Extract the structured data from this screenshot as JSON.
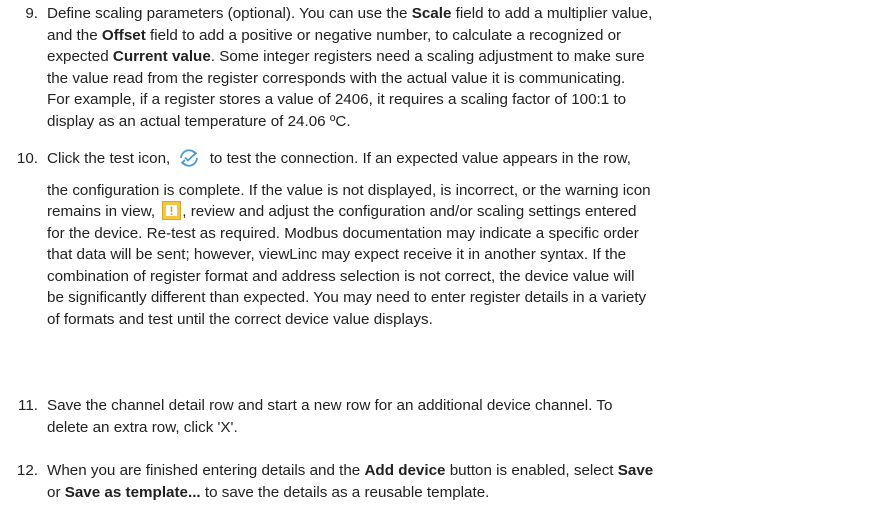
{
  "steps": [
    {
      "number": "9.",
      "lines": [
        {
          "parts": [
            {
              "t": "Define scaling parameters (optional). You can use the "
            },
            {
              "t": "Scale",
              "b": true
            },
            {
              "t": " field to add a multiplier value,"
            }
          ]
        },
        {
          "parts": [
            {
              "t": "and the "
            },
            {
              "t": "Offset",
              "b": true
            },
            {
              "t": " field to add a positive or negative number, to calculate a recognized or"
            }
          ]
        },
        {
          "parts": [
            {
              "t": "expected "
            },
            {
              "t": "Current value",
              "b": true
            },
            {
              "t": ". Some integer registers need a scaling adjustment to make sure"
            }
          ]
        },
        {
          "parts": [
            {
              "t": "the value read from the register corresponds with the actual value it is communicating."
            }
          ]
        },
        {
          "parts": [
            {
              "t": "For example, if a register stores a value of 2406, it requires a scaling factor of 100:1 to"
            }
          ]
        },
        {
          "parts": [
            {
              "t": "display as an actual temperature of 24.06 ºC."
            }
          ]
        }
      ]
    },
    {
      "number": "10.",
      "lines": [
        {
          "parts": [
            {
              "t": "Click the test icon, "
            },
            {
              "icon": "test-icon"
            },
            {
              "t": " to test the connection. If an expected value appears in the row,"
            }
          ]
        },
        {
          "gap": true
        },
        {
          "parts": [
            {
              "t": "the configuration is complete. If the value is not displayed, is incorrect, or the warning icon"
            }
          ]
        },
        {
          "parts": [
            {
              "t": "remains in view, "
            },
            {
              "icon": "warning-icon"
            },
            {
              "t": ", review and adjust the configuration and/or scaling settings entered"
            }
          ]
        },
        {
          "parts": [
            {
              "t": "for the device. Re-test as required. Modbus documentation may indicate a specific order"
            }
          ]
        },
        {
          "parts": [
            {
              "t": "that data will be sent; however, viewLinc may expect receive it in another syntax. If the"
            }
          ]
        },
        {
          "parts": [
            {
              "t": "combination of register format and address selection is not correct, the device value will"
            }
          ]
        },
        {
          "parts": [
            {
              "t": "be significantly different than expected. You may need to enter register details in a variety"
            }
          ]
        },
        {
          "parts": [
            {
              "t": "of formats and test until the correct device value displays."
            }
          ]
        }
      ]
    },
    {
      "number": "11.",
      "lines": [
        {
          "parts": [
            {
              "t": "Save the channel detail row and start a new row for an additional device channel. To"
            }
          ]
        },
        {
          "parts": [
            {
              "t": "delete an extra row, click 'X'."
            }
          ]
        }
      ]
    },
    {
      "number": "12.",
      "lines": [
        {
          "parts": [
            {
              "t": "When you are finished entering details and the "
            },
            {
              "t": "Add device",
              "b": true
            },
            {
              "t": " button is enabled, select "
            },
            {
              "t": "Save",
              "b": true
            }
          ]
        },
        {
          "parts": [
            {
              "t": "or "
            },
            {
              "t": "Save as template...",
              "b": true
            },
            {
              "t": " to save the details as a reusable template."
            }
          ]
        }
      ]
    }
  ],
  "icons": {
    "test-icon": {
      "name": "test-icon",
      "color": "#4a9bd1"
    },
    "warning-icon": {
      "name": "warning-icon",
      "fill": "#f2c744",
      "border": "#d8a820",
      "glyph": "!"
    }
  }
}
